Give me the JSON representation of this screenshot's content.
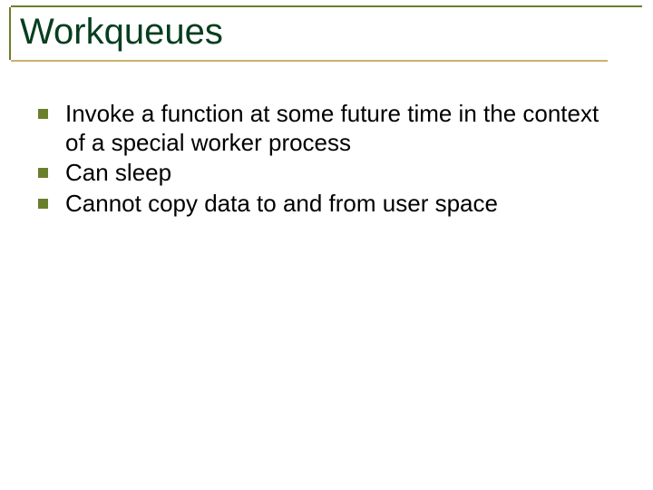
{
  "slide": {
    "title": "Workqueues",
    "bullets": [
      "Invoke a function at some future time in the context of a special worker process",
      "Can sleep",
      "Cannot copy data to and from user space"
    ]
  }
}
